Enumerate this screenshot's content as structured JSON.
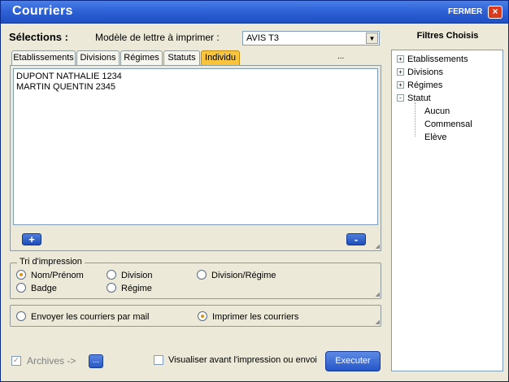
{
  "window": {
    "title": "Courriers",
    "close_label": "FERMER",
    "close_icon": "×"
  },
  "selections": {
    "label": "Sélections :",
    "model_label": "Modèle de lettre à imprimer :",
    "model_value": "AVIS T3",
    "arrow": "▼"
  },
  "tabs": [
    {
      "label": "Etablissements",
      "active": false
    },
    {
      "label": "Divisions",
      "active": false
    },
    {
      "label": "Régimes",
      "active": false
    },
    {
      "label": "Statuts",
      "active": false
    },
    {
      "label": "Individu",
      "active": true
    }
  ],
  "tab_overflow": "...",
  "list": {
    "items": [
      "DUPONT NATHALIE 1234",
      "MARTIN QUENTIN 2345"
    ],
    "add_label": "+",
    "remove_label": "-"
  },
  "tri": {
    "title": "Tri d'impression",
    "options": [
      {
        "label": "Nom/Prénom",
        "checked": true
      },
      {
        "label": "Division",
        "checked": false
      },
      {
        "label": "Division/Régime",
        "checked": false
      },
      {
        "label": "Badge",
        "checked": false
      },
      {
        "label": "Régime",
        "checked": false
      }
    ]
  },
  "delivery": {
    "options": [
      {
        "label": "Envoyer les courriers par mail",
        "checked": false
      },
      {
        "label": "Imprimer les courriers",
        "checked": true
      }
    ]
  },
  "filters": {
    "title": "Filtres Choisis",
    "tree": [
      {
        "label": "Etablissements",
        "toggle": "+"
      },
      {
        "label": "Divisions",
        "toggle": "+"
      },
      {
        "label": "Régimes",
        "toggle": "+"
      },
      {
        "label": "Statut",
        "toggle": "-"
      },
      {
        "label": "Aucun"
      },
      {
        "label": "Commensal"
      },
      {
        "label": "Elève"
      }
    ]
  },
  "footer": {
    "archives_checked": true,
    "archives_label": "Archives ->",
    "archives_button": "...",
    "visualiser_checked": false,
    "visualiser_label": "Visualiser avant l'impression ou envoi",
    "execute_label": "Executer"
  },
  "colors": {
    "titlebar": "#2f62d6",
    "active_tab": "#f7c43b",
    "radio_dot": "#e29014"
  }
}
